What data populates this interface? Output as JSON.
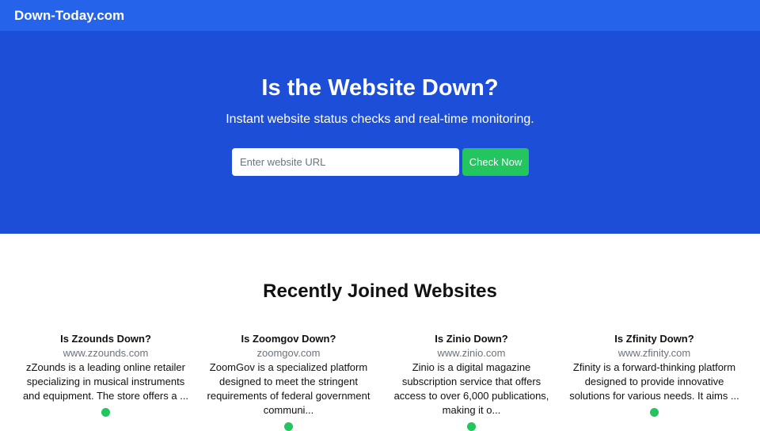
{
  "nav": {
    "brand": "Down-Today.com"
  },
  "hero": {
    "title": "Is the Website Down?",
    "subtitle": "Instant website status checks and real-time monitoring.",
    "search_placeholder": "Enter website URL",
    "check_button": "Check Now"
  },
  "recent": {
    "title": "Recently Joined Websites",
    "cards": [
      {
        "title": "Is Zzounds Down?",
        "url": "www.zzounds.com",
        "desc": "zZounds is a leading online retailer specializing in musical instruments and equipment. The store offers a ...",
        "status": "up"
      },
      {
        "title": "Is Zoomgov Down?",
        "url": "zoomgov.com",
        "desc": "ZoomGov is a specialized platform designed to meet the stringent requirements of federal government communi...",
        "status": "up"
      },
      {
        "title": "Is Zinio Down?",
        "url": "www.zinio.com",
        "desc": "Zinio is a digital magazine subscription service that offers access to over 6,000 publications, making it o...",
        "status": "up"
      },
      {
        "title": "Is Zfinity Down?",
        "url": "www.zfinity.com",
        "desc": "Zfinity is a forward-thinking platform designed to provide innovative solutions for various needs. It aims ...",
        "status": "up"
      }
    ]
  },
  "colors": {
    "nav": "#2563eb",
    "hero": "#1d4ed8",
    "accent": "#22c55e"
  }
}
